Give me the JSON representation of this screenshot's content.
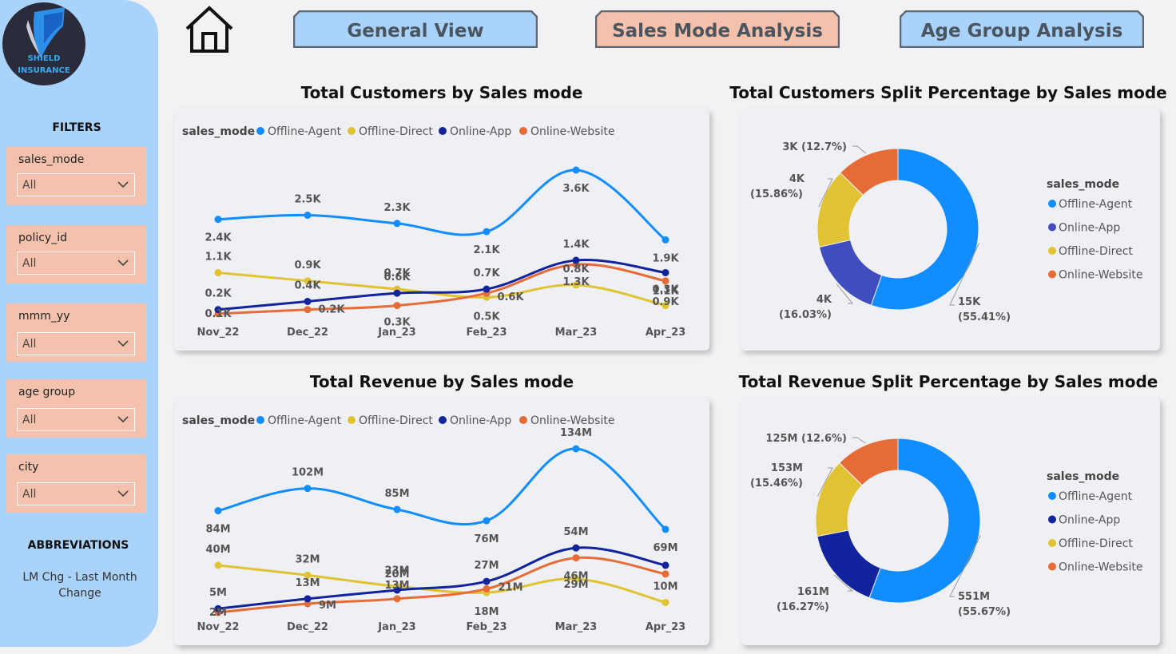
{
  "logo": {
    "line1": "SHIELD",
    "line2": "INSURANCE"
  },
  "nav": {
    "general": "General View",
    "sales_mode": "Sales Mode Analysis",
    "age_group": "Age Group Analysis"
  },
  "sidebar": {
    "filters_title": "FILTERS",
    "filters": [
      {
        "label": "sales_mode",
        "value": "All"
      },
      {
        "label": "policy_id",
        "value": "All"
      },
      {
        "label": "mmm_yy",
        "value": "All"
      },
      {
        "label": "age group",
        "value": "All"
      },
      {
        "label": "city",
        "value": "All"
      }
    ],
    "abbr_title": "ABBREVIATIONS",
    "abbr_line1": "LM Chg - Last Month",
    "abbr_line2": "Change"
  },
  "titles": {
    "customers_line": "Total Customers by Sales mode",
    "customers_donut": "Total Customers Split Percentage by Sales mode",
    "revenue_line": "Total Revenue by Sales mode",
    "revenue_donut": "Total Revenue Split Percentage by Sales mode"
  },
  "colors": {
    "Offline-Agent": "#118DFF",
    "Offline-Direct": "#E1C233",
    "Online-App": "#12239E",
    "Online-App-donut1": "#3F4DBF",
    "Online-Website": "#E66C37",
    "sidebar": "#A9D3FA",
    "filter": "#F4C2AC"
  },
  "chart_data": [
    {
      "type": "line",
      "title": "Total Customers by Sales mode",
      "legend_title": "sales_mode",
      "legend_position": "top-left",
      "categories": [
        "Nov_22",
        "Dec_22",
        "Jan_23",
        "Feb_23",
        "Mar_23",
        "Apr_23"
      ],
      "series": [
        {
          "name": "Offline-Agent",
          "values": [
            2.4,
            2.5,
            2.3,
            2.1,
            3.6,
            1.9
          ],
          "labels": [
            "2.4K",
            "2.5K",
            "2.3K",
            "2.1K",
            "3.6K",
            "1.9K"
          ]
        },
        {
          "name": "Offline-Direct",
          "values": [
            1.1,
            0.9,
            0.7,
            0.5,
            0.8,
            0.3
          ],
          "labels": [
            "1.1K",
            "0.9K",
            "0.7K",
            "0.5K",
            "0.8K",
            "0.3K"
          ]
        },
        {
          "name": "Online-App",
          "values": [
            0.2,
            0.4,
            0.6,
            0.7,
            1.4,
            1.1
          ],
          "labels": [
            "0.2K",
            "0.4K",
            "0.6K",
            "0.7K",
            "1.4K",
            "1.1K"
          ]
        },
        {
          "name": "Online-Website",
          "values": [
            0.1,
            0.2,
            0.3,
            0.6,
            1.3,
            0.9
          ],
          "labels": [
            "0.1K",
            "0.2K",
            "0.3K",
            "0.6K",
            "1.3K",
            "0.9K"
          ]
        }
      ]
    },
    {
      "type": "pie",
      "title": "Total Customers Split Percentage by Sales mode",
      "legend_title": "sales_mode",
      "legend_position": "right",
      "legend": [
        "Offline-Agent",
        "Online-App",
        "Offline-Direct",
        "Online-Website"
      ],
      "slices": [
        {
          "name": "Offline-Agent",
          "value": 55.41,
          "label1": "15K",
          "label2": "(55.41%)"
        },
        {
          "name": "Online-App",
          "value": 16.03,
          "label1": "4K",
          "label2": "(16.03%)"
        },
        {
          "name": "Offline-Direct",
          "value": 15.86,
          "label1": "4K",
          "label2": "(15.86%)"
        },
        {
          "name": "Online-Website",
          "value": 12.7,
          "label1": "3K (12.7%)",
          "label2": ""
        }
      ]
    },
    {
      "type": "line",
      "title": "Total Revenue by Sales mode",
      "legend_title": "sales_mode",
      "legend_position": "top-left",
      "categories": [
        "Nov_22",
        "Dec_22",
        "Jan_23",
        "Feb_23",
        "Mar_23",
        "Apr_23"
      ],
      "series": [
        {
          "name": "Offline-Agent",
          "values": [
            84,
            102,
            85,
            76,
            134,
            69
          ],
          "labels": [
            "84M",
            "102M",
            "85M",
            "76M",
            "134M",
            "69M"
          ]
        },
        {
          "name": "Offline-Direct",
          "values": [
            40,
            32,
            23,
            18,
            29,
            10
          ],
          "labels": [
            "40M",
            "32M",
            "23M",
            "18M",
            "29M",
            "10M"
          ]
        },
        {
          "name": "Online-App",
          "values": [
            5,
            13,
            20,
            27,
            54,
            40
          ],
          "labels": [
            "5M",
            "13M",
            "20M",
            "27M",
            "54M",
            ""
          ]
        },
        {
          "name": "Online-Website",
          "values": [
            2,
            9,
            13,
            21,
            46,
            33
          ],
          "labels": [
            "2M",
            "9M",
            "13M",
            "21M",
            "46M",
            ""
          ]
        }
      ]
    },
    {
      "type": "pie",
      "title": "Total Revenue Split Percentage by Sales mode",
      "legend_title": "sales_mode",
      "legend_position": "right",
      "legend": [
        "Offline-Agent",
        "Online-App",
        "Offline-Direct",
        "Online-Website"
      ],
      "slices": [
        {
          "name": "Offline-Agent",
          "value": 55.67,
          "label1": "551M",
          "label2": "(55.67%)"
        },
        {
          "name": "Online-App",
          "value": 16.27,
          "label1": "161M",
          "label2": "(16.27%)"
        },
        {
          "name": "Offline-Direct",
          "value": 15.46,
          "label1": "153M",
          "label2": "(15.46%)"
        },
        {
          "name": "Online-Website",
          "value": 12.6,
          "label1": "125M (12.6%)",
          "label2": ""
        }
      ]
    }
  ]
}
